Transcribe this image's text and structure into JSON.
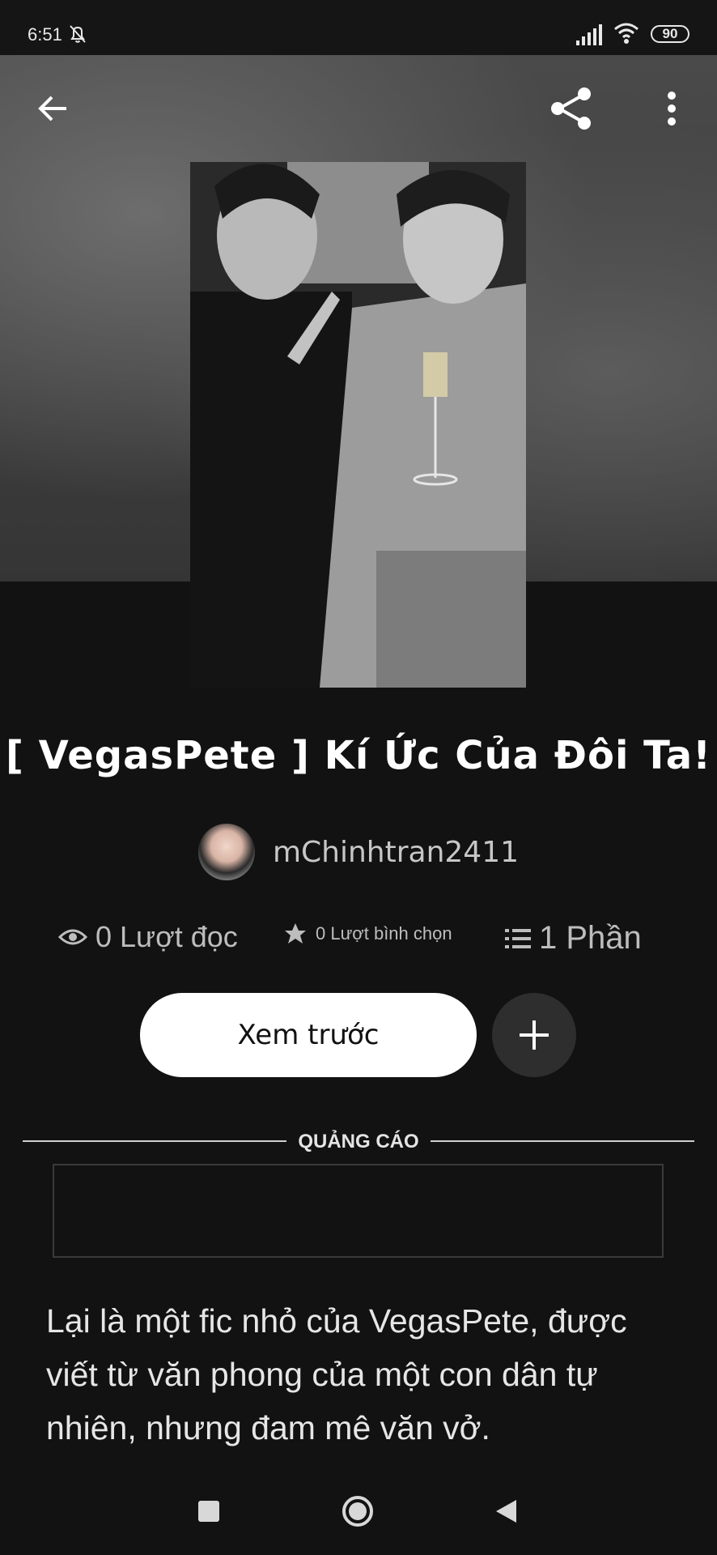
{
  "status_bar": {
    "time": "6:51",
    "battery": "90",
    "icons": [
      "bell-off-icon",
      "signal-icon",
      "wifi-icon",
      "battery-icon"
    ]
  },
  "toolbar": {
    "icons": [
      "back-arrow-icon",
      "share-icon",
      "more-vertical-icon"
    ]
  },
  "story": {
    "title": "[ VegasPete ] Kí Ức Của Đôi Ta!",
    "author": "mChinhtran2411",
    "stats": {
      "reads": "0 Lượt đọc",
      "votes": "0 Lượt bình chọn",
      "parts": "1 Phần"
    },
    "preview_label": "Xem trước",
    "description": "Lại là một fic nhỏ của VegasPete, được viết từ văn phong của một con dân tự nhiên, nhưng đam mê văn vở."
  },
  "ad": {
    "label": "QUẢNG CÁO"
  },
  "colors": {
    "background": "#121212",
    "button_light": "#ffffff",
    "button_dark": "#2e2e2e",
    "muted_text": "#bdbdbd"
  }
}
